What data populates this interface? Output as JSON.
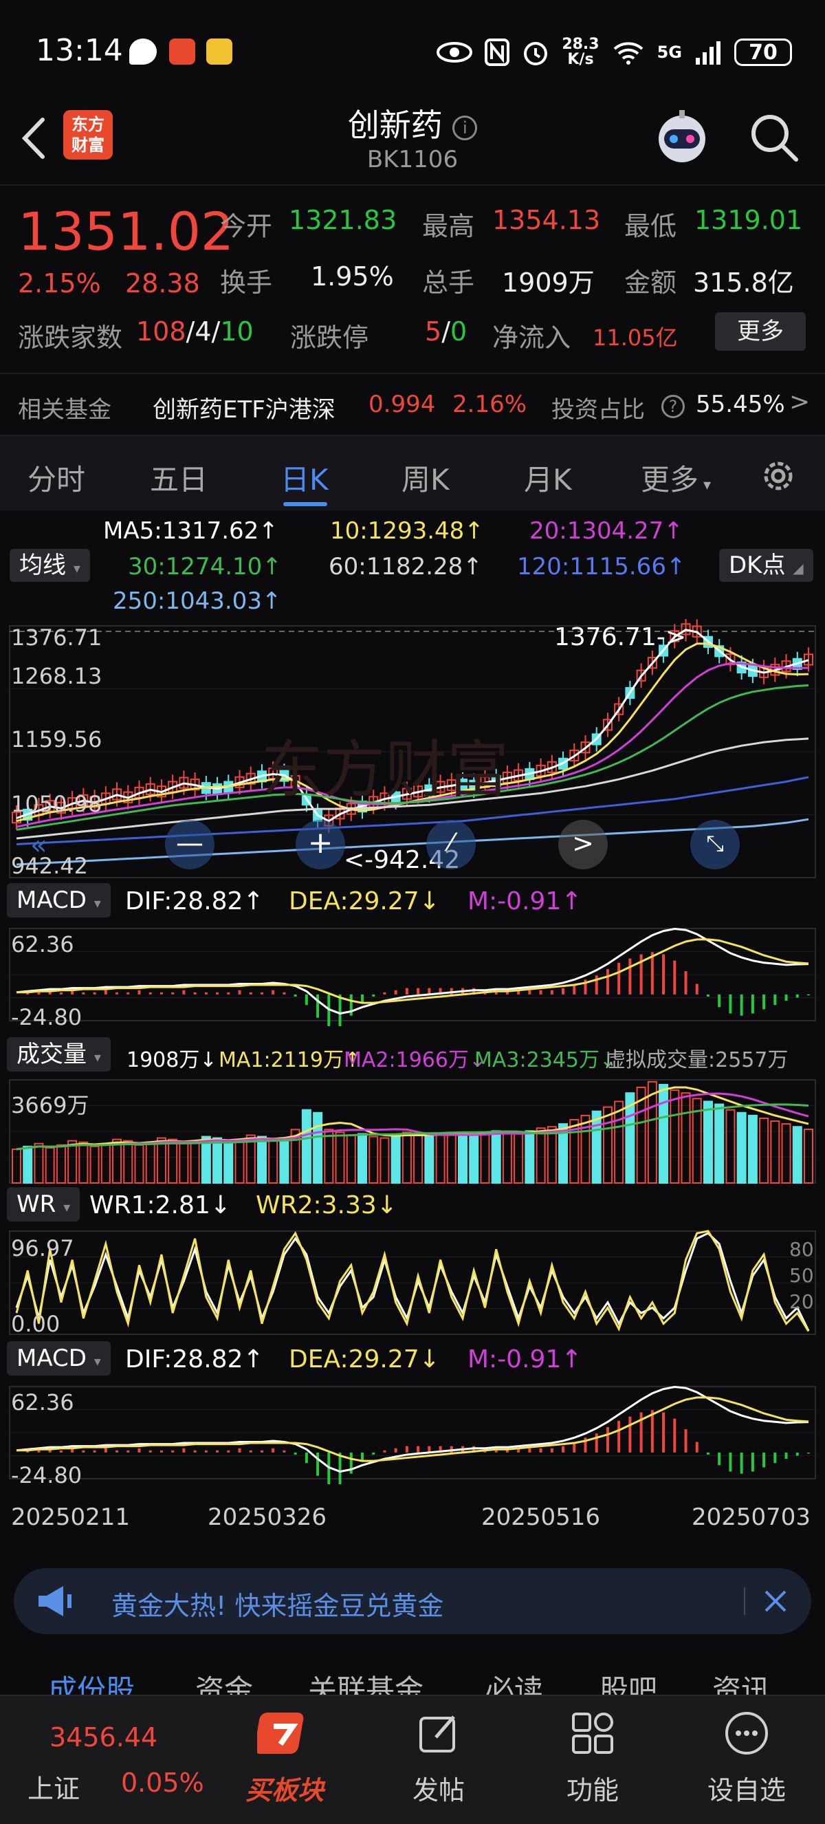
{
  "status": {
    "time": "13:14",
    "net_speed_top": "28.3",
    "net_speed_bottom": "K/s",
    "network": "5G",
    "battery": "70"
  },
  "header": {
    "logo_line1": "东方",
    "logo_line2": "财富",
    "title": "创新药",
    "code": "BK1106"
  },
  "quote": {
    "price": "1351.02",
    "change_pct": "2.15%",
    "change": "28.38",
    "open_label": "今开",
    "open": "1321.83",
    "high_label": "最高",
    "high": "1354.13",
    "low_label": "最低",
    "low": "1319.01",
    "turnover_label": "换手",
    "turnover": "1.95%",
    "volume_label": "总手",
    "volume": "1909万",
    "amount_label": "金额",
    "amount": "315.8亿",
    "updown_label": "涨跌家数",
    "up_count": "108",
    "sep1": "/",
    "flat_count": "4",
    "sep2": "/",
    "down_count": "10",
    "limit_label": "涨跌停",
    "limit_up": "5",
    "sep3": "/",
    "limit_down": "0",
    "inflow_label": "净流入",
    "inflow": "11.05亿",
    "more_label": "更多",
    "fund_label": "相关基金",
    "fund_name": "创新药ETF沪港深",
    "fund_price": "0.994",
    "fund_pct": "2.16%",
    "ratio_label": "投资占比",
    "ratio": "55.45%"
  },
  "tabs": [
    "分时",
    "五日",
    "日K",
    "周K",
    "月K",
    "更多"
  ],
  "active_tab": 2,
  "ma_legend": {
    "pill": "均线",
    "dk": "DK点",
    "ma5": "MA5:1317.62↑",
    "ma10": "10:1293.48↑",
    "ma20": "20:1304.27↑",
    "ma30": "30:1274.10↑",
    "ma60": "60:1182.28↑",
    "ma120": "120:1115.66↑",
    "ma250": "250:1043.03↑"
  },
  "colors": {
    "up": "#f2463c",
    "down": "#25c93e",
    "ma5": "#ffffff",
    "ma10": "#f5e35a",
    "ma20": "#d23fd8",
    "ma30": "#3fb950",
    "ma60": "#d8d8d8",
    "ma120": "#3f5fd8",
    "ma250": "#7fb6ee",
    "vol_down": "#5ce6e6"
  },
  "chart_data": [
    {
      "type": "candlestick",
      "title": "",
      "y_ticks": [
        "1376.71",
        "1268.13",
        "1159.56",
        "1050.98",
        "942.42"
      ],
      "ylim": [
        942.42,
        1376.71
      ],
      "max_label": "1376.71->",
      "min_label": "<-942.42",
      "x_ticks": [
        "20250211",
        "20250326",
        "20250516",
        "20250703"
      ],
      "series": [
        {
          "name": "MA5",
          "values": [
            1045,
            1052,
            1058,
            1065,
            1062,
            1070,
            1075,
            1072,
            1078,
            1085,
            1080,
            1088,
            1094,
            1090,
            1098,
            1105,
            1102,
            1098,
            1096,
            1100,
            1106,
            1112,
            1118,
            1121,
            1119,
            1108,
            1078,
            1050,
            1040,
            1052,
            1060,
            1066,
            1072,
            1078,
            1082,
            1086,
            1090,
            1094,
            1098,
            1101,
            1104,
            1102,
            1106,
            1110,
            1114,
            1118,
            1122,
            1126,
            1132,
            1140,
            1152,
            1166,
            1182,
            1205,
            1232,
            1262,
            1290,
            1312,
            1335,
            1358,
            1370,
            1366,
            1350,
            1334,
            1318,
            1306,
            1300,
            1296,
            1300,
            1306,
            1312,
            1317.62
          ]
        },
        {
          "name": "MA10",
          "values": [
            1040,
            1045,
            1050,
            1055,
            1058,
            1061,
            1064,
            1066,
            1069,
            1073,
            1076,
            1079,
            1083,
            1086,
            1089,
            1093,
            1096,
            1098,
            1099,
            1100,
            1103,
            1106,
            1109,
            1112,
            1113,
            1110,
            1100,
            1088,
            1076,
            1066,
            1060,
            1058,
            1060,
            1064,
            1068,
            1072,
            1076,
            1080,
            1084,
            1088,
            1092,
            1096,
            1099,
            1102,
            1105,
            1108,
            1112,
            1116,
            1120,
            1126,
            1134,
            1144,
            1156,
            1172,
            1192,
            1216,
            1242,
            1268,
            1294,
            1318,
            1336,
            1346,
            1346,
            1340,
            1332,
            1322,
            1312,
            1304,
            1298,
            1294,
            1293,
            1293.48
          ]
        },
        {
          "name": "MA20",
          "values": [
            1030,
            1034,
            1038,
            1042,
            1045,
            1048,
            1051,
            1054,
            1057,
            1060,
            1063,
            1066,
            1069,
            1072,
            1075,
            1078,
            1081,
            1084,
            1086,
            1088,
            1090,
            1092,
            1094,
            1096,
            1098,
            1098,
            1095,
            1090,
            1084,
            1078,
            1073,
            1070,
            1069,
            1069,
            1070,
            1072,
            1074,
            1077,
            1080,
            1083,
            1086,
            1089,
            1092,
            1095,
            1098,
            1101,
            1104,
            1108,
            1112,
            1117,
            1123,
            1130,
            1139,
            1150,
            1163,
            1178,
            1195,
            1214,
            1234,
            1254,
            1272,
            1288,
            1300,
            1308,
            1312,
            1312,
            1310,
            1307,
            1305,
            1304,
            1304,
            1304.27
          ]
        },
        {
          "name": "MA30",
          "values": [
            1025,
            1028,
            1031,
            1034,
            1037,
            1040,
            1043,
            1046,
            1049,
            1052,
            1055,
            1058,
            1061,
            1064,
            1067,
            1069,
            1071,
            1073,
            1075,
            1077,
            1079,
            1081,
            1083,
            1085,
            1086,
            1087,
            1086,
            1084,
            1081,
            1078,
            1075,
            1073,
            1072,
            1071,
            1071,
            1072,
            1073,
            1075,
            1077,
            1079,
            1082,
            1084,
            1087,
            1090,
            1093,
            1096,
            1099,
            1102,
            1106,
            1110,
            1115,
            1120,
            1126,
            1133,
            1141,
            1150,
            1160,
            1171,
            1183,
            1196,
            1209,
            1222,
            1234,
            1244,
            1252,
            1258,
            1263,
            1266,
            1269,
            1271,
            1273,
            1274.1
          ]
        },
        {
          "name": "MA60",
          "values": [
            1010,
            1012,
            1014,
            1016,
            1018,
            1020,
            1022,
            1024,
            1026,
            1028,
            1030,
            1032,
            1034,
            1036,
            1038,
            1040,
            1042,
            1044,
            1046,
            1048,
            1050,
            1052,
            1054,
            1056,
            1058,
            1059,
            1060,
            1061,
            1061,
            1061,
            1062,
            1062,
            1063,
            1064,
            1065,
            1066,
            1067,
            1068,
            1070,
            1072,
            1074,
            1076,
            1078,
            1080,
            1082,
            1084,
            1086,
            1088,
            1091,
            1094,
            1097,
            1100,
            1104,
            1108,
            1112,
            1117,
            1122,
            1127,
            1133,
            1139,
            1145,
            1151,
            1157,
            1162,
            1166,
            1170,
            1173,
            1176,
            1178,
            1180,
            1181,
            1182.28
          ]
        },
        {
          "name": "MA120",
          "values": [
            1000,
            1001,
            1002,
            1003,
            1004,
            1005,
            1006,
            1007,
            1008,
            1009,
            1010,
            1011,
            1012,
            1013,
            1014,
            1015,
            1016,
            1017,
            1018,
            1019,
            1020,
            1021,
            1022,
            1023,
            1024,
            1025,
            1026,
            1027,
            1028,
            1029,
            1030,
            1031,
            1032,
            1033,
            1034,
            1035,
            1036,
            1037,
            1038,
            1039,
            1040,
            1042,
            1044,
            1046,
            1048,
            1050,
            1052,
            1054,
            1056,
            1058,
            1060,
            1062,
            1064,
            1066,
            1068,
            1070,
            1072,
            1074,
            1076,
            1078,
            1081,
            1084,
            1087,
            1090,
            1093,
            1096,
            1099,
            1102,
            1105,
            1108,
            1112,
            1115.66
          ]
        },
        {
          "name": "MA250",
          "values": [
            965,
            966,
            967,
            968,
            969,
            970,
            971,
            972,
            973,
            974,
            975,
            976,
            977,
            978,
            979,
            980,
            981,
            982,
            983,
            984,
            985,
            986,
            987,
            988,
            989,
            990,
            991,
            992,
            993,
            994,
            995,
            996,
            997,
            998,
            999,
            1000,
            1001,
            1002,
            1003,
            1004,
            1005,
            1006,
            1007,
            1008,
            1009,
            1010,
            1011,
            1012,
            1013,
            1014,
            1015,
            1016,
            1017,
            1018,
            1019,
            1020,
            1021,
            1022,
            1023,
            1024,
            1025,
            1026,
            1027,
            1028,
            1029,
            1030,
            1031,
            1033,
            1035,
            1037,
            1040,
            1043.03
          ]
        }
      ]
    },
    {
      "type": "bar",
      "name": "MACD",
      "label": "MACD",
      "dif": "DIF:28.82↑",
      "dea": "DEA:29.27↓",
      "m": "M:-0.91↑",
      "y_ticks": [
        "62.36",
        "-24.80"
      ],
      "ylim": [
        -24.8,
        62.36
      ],
      "dif_values": [
        2,
        3,
        4,
        5,
        5,
        6,
        6,
        6,
        7,
        7,
        7,
        8,
        8,
        8,
        8,
        9,
        9,
        9,
        9,
        9,
        10,
        10,
        10,
        11,
        10,
        8,
        3,
        -6,
        -14,
        -18,
        -16,
        -12,
        -9,
        -6,
        -4,
        -2,
        -1,
        0,
        1,
        2,
        3,
        4,
        4,
        5,
        5,
        6,
        7,
        8,
        9,
        11,
        14,
        18,
        23,
        29,
        36,
        43,
        50,
        56,
        60,
        62,
        61,
        57,
        51,
        45,
        39,
        35,
        32,
        30,
        29,
        28,
        28.5,
        28.82
      ],
      "dea_values": [
        2,
        2,
        3,
        3,
        4,
        4,
        5,
        5,
        5,
        6,
        6,
        6,
        7,
        7,
        7,
        7,
        8,
        8,
        8,
        8,
        8,
        9,
        9,
        9,
        9,
        9,
        8,
        5,
        1,
        -3,
        -6,
        -8,
        -8,
        -7,
        -6,
        -5,
        -4,
        -3,
        -2,
        -1,
        0,
        1,
        2,
        3,
        3,
        4,
        5,
        6,
        7,
        8,
        9,
        11,
        14,
        17,
        21,
        26,
        31,
        36,
        41,
        46,
        50,
        52,
        52,
        51,
        48,
        45,
        41,
        37,
        34,
        31,
        30,
        29.27
      ]
    },
    {
      "type": "bar",
      "name": "成交量",
      "label": "成交量",
      "vol": "1908万↓",
      "ma1": "MA1:2119万↑",
      "ma2": "MA2:1966万↓",
      "ma3": "MA3:2345万↓",
      "virtual": "虚拟成交量:2557万",
      "y_ticks": [
        "3669万"
      ],
      "ylim": [
        0,
        3669
      ],
      "values": [
        1200,
        1300,
        1400,
        1250,
        1350,
        1500,
        1450,
        1300,
        1400,
        1550,
        1500,
        1350,
        1450,
        1600,
        1550,
        1400,
        1500,
        1650,
        1600,
        1450,
        1550,
        1700,
        1650,
        1500,
        1600,
        1900,
        2600,
        2500,
        1900,
        1800,
        1700,
        1750,
        1650,
        1600,
        1700,
        1800,
        1750,
        1650,
        1700,
        1800,
        1750,
        1700,
        1800,
        1850,
        1800,
        1750,
        1850,
        1950,
        2000,
        2100,
        2250,
        2400,
        2550,
        2700,
        2900,
        3200,
        3400,
        3600,
        3500,
        3300,
        3200,
        3000,
        2900,
        2800,
        2600,
        2500,
        2400,
        2300,
        2200,
        2100,
        2000,
        1908
      ]
    },
    {
      "type": "line",
      "name": "WR",
      "label": "WR",
      "wr1": "WR1:2.81↓",
      "wr2": "WR2:3.33↓",
      "y_ticks": [
        "96.97",
        "0.00"
      ],
      "right_ticks": [
        "80",
        "50",
        "20"
      ],
      "ylim": [
        0,
        96.97
      ],
      "wr1_values": [
        20,
        60,
        10,
        80,
        30,
        70,
        15,
        50,
        85,
        40,
        10,
        65,
        30,
        75,
        20,
        55,
        90,
        35,
        15,
        70,
        25,
        60,
        10,
        45,
        80,
        95,
        70,
        30,
        15,
        50,
        65,
        20,
        40,
        75,
        30,
        10,
        55,
        20,
        70,
        35,
        15,
        60,
        25,
        80,
        40,
        10,
        50,
        20,
        65,
        30,
        15,
        40,
        10,
        25,
        5,
        35,
        15,
        30,
        10,
        20,
        70,
        95,
        97,
        80,
        40,
        15,
        60,
        75,
        30,
        10,
        20,
        2.81
      ],
      "wr2_values": [
        25,
        55,
        15,
        70,
        35,
        65,
        20,
        45,
        75,
        45,
        15,
        60,
        35,
        70,
        25,
        50,
        80,
        40,
        20,
        65,
        30,
        55,
        15,
        40,
        75,
        90,
        75,
        35,
        20,
        45,
        60,
        25,
        35,
        70,
        35,
        15,
        50,
        25,
        65,
        40,
        20,
        55,
        30,
        75,
        45,
        15,
        45,
        25,
        60,
        35,
        20,
        35,
        15,
        30,
        10,
        30,
        20,
        25,
        15,
        25,
        60,
        90,
        95,
        85,
        50,
        20,
        55,
        70,
        35,
        15,
        25,
        3.33
      ]
    },
    {
      "type": "bar",
      "name": "MACD",
      "label": "MACD",
      "dif": "DIF:28.82↑",
      "dea": "DEA:29.27↓",
      "m": "M:-0.91↑",
      "y_ticks": [
        "62.36",
        "-24.80"
      ],
      "ylim": [
        -24.8,
        62.36
      ]
    }
  ],
  "banner": {
    "text": "黄金大热! 快来摇金豆兑黄金"
  },
  "section_tabs": [
    "成份股",
    "资金",
    "关联基金",
    "必读",
    "股吧",
    "资讯"
  ],
  "bottom_nav": {
    "index_value": "3456.44",
    "index_name": "上证",
    "index_pct": "0.05%",
    "buy_label": "买板块",
    "post_label": "发帖",
    "func_label": "功能",
    "watch_label": "设自选"
  }
}
